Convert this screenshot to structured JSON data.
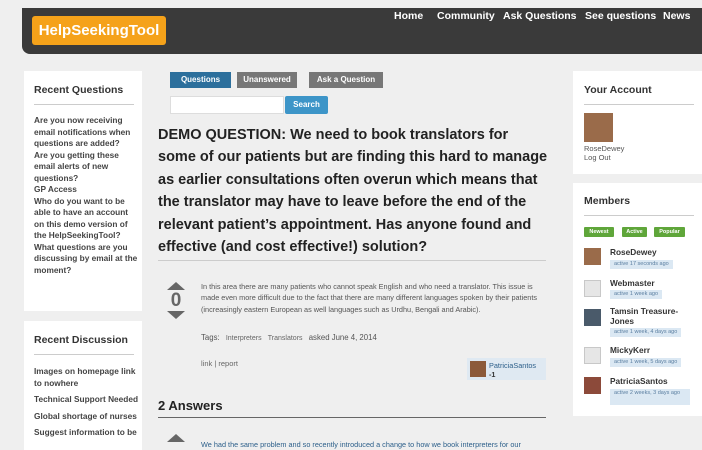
{
  "header": {
    "logo": "HelpSeekingTool",
    "nav": [
      "Home",
      "Community",
      "Ask Questions",
      "See questions",
      "News"
    ]
  },
  "recent_questions": {
    "title": "Recent Questions",
    "items": [
      "Are you now receiving email notifications when questions are added?",
      "Are you getting these email alerts of new questions?",
      "GP Access",
      "Who do you want to be able to have an account on this demo version of the HelpSeekingTool?",
      "What questions are you discussing by email at the moment?"
    ]
  },
  "recent_discussion": {
    "title": "Recent Discussion",
    "items": [
      "Images on homepage link to nowhere",
      "Technical Support Needed",
      "Global shortage of nurses",
      "Suggest information to be"
    ]
  },
  "tabs": [
    "Questions",
    "Unanswered",
    "Ask a Question"
  ],
  "search": {
    "placeholder": "",
    "button": "Search"
  },
  "question": {
    "title": "DEMO QUESTION: We need to book translators for some of our patients but are finding this hard to manage as earlier consultations often overun which means that the translator may have to leave before the end of the relevant patient’s appointment. Has anyone found and effective (and cost effective!) solution?",
    "votes": "0",
    "body": "In this area there are many patients who cannot speak English and who need a translator. This issue is made even more difficult due to the fact that there are many different languages spoken by their patients (increasingly eastern European as well languages such as Urdhu, Bengali and Arabic).",
    "tags_label": "Tags:",
    "tags": [
      "Interpreters",
      "Translators"
    ],
    "asked": "asked June 4, 2014",
    "actions": "link | report",
    "author": {
      "name": "PatriciaSantos",
      "score": "-1"
    }
  },
  "answers": {
    "title": "2 Answers",
    "first_text": "We had the same problem and so recently introduced a change to how we book interpreters for our"
  },
  "account": {
    "title": "Your Account",
    "username": "RoseDewey",
    "logout": "Log Out"
  },
  "members": {
    "title": "Members",
    "filters": [
      "Newest",
      "Active",
      "Popular"
    ],
    "list": [
      {
        "name": "RoseDewey",
        "activity": "active 17 seconds ago"
      },
      {
        "name": "Webmaster",
        "activity": "active 1 week ago"
      },
      {
        "name": "Tamsin Treasure-Jones",
        "activity": "active 1 week, 4 days ago"
      },
      {
        "name": "MickyKerr",
        "activity": "active 1 week, 5 days ago"
      },
      {
        "name": "PatriciaSantos",
        "activity": "active 2 weeks, 3 days ago"
      }
    ]
  },
  "colors": {
    "header_bg": "#3a3a3a",
    "logo_bg": "#f5a21a",
    "tab_active": "#2c6f9c",
    "tab_inactive": "#777777",
    "accent_blue": "#3d95c8",
    "badge_green": "#5fa63a"
  }
}
